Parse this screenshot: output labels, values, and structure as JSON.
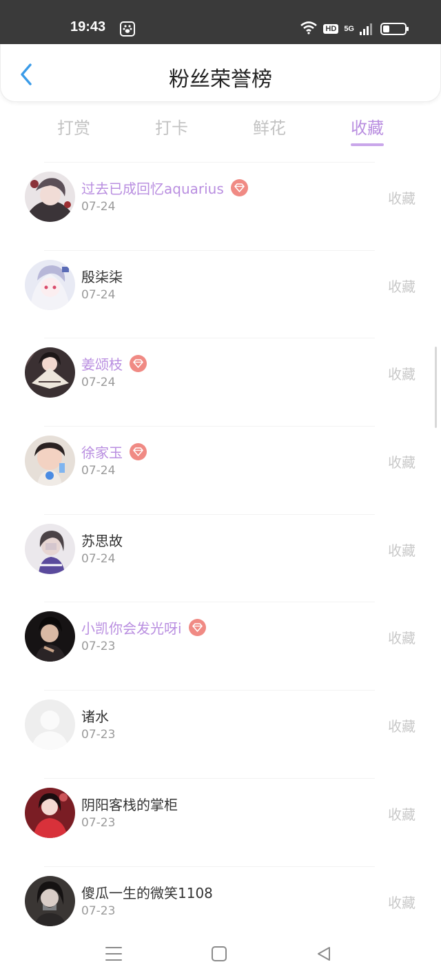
{
  "status_bar": {
    "time": "19:43",
    "hd_label": "HD",
    "network_label": "5G",
    "battery_level": 0.3,
    "icons": [
      "paw-icon",
      "wifi-icon",
      "signal-icon",
      "battery-icon"
    ]
  },
  "header": {
    "title": "粉丝荣誉榜",
    "back_icon": "chevron-left-icon"
  },
  "tabs": [
    {
      "label": "打赏",
      "active": false
    },
    {
      "label": "打卡",
      "active": false
    },
    {
      "label": "鲜花",
      "active": false
    },
    {
      "label": "收藏",
      "active": true
    }
  ],
  "fans": [
    {
      "name": "过去已成回忆aquarius",
      "date": "07-24",
      "action": "收藏",
      "vip": true
    },
    {
      "name": "殷柒柒",
      "date": "07-24",
      "action": "收藏",
      "vip": false
    },
    {
      "name": "姜颂枝",
      "date": "07-24",
      "action": "收藏",
      "vip": true
    },
    {
      "name": "徐家玉",
      "date": "07-24",
      "action": "收藏",
      "vip": true
    },
    {
      "name": "苏思故",
      "date": "07-24",
      "action": "收藏",
      "vip": false
    },
    {
      "name": "小凯你会发光呀i",
      "date": "07-23",
      "action": "收藏",
      "vip": true
    },
    {
      "name": "诸水",
      "date": "07-23",
      "action": "收藏",
      "vip": false
    },
    {
      "name": "阴阳客栈的掌柜",
      "date": "07-23",
      "action": "收藏",
      "vip": false
    },
    {
      "name": "傻瓜一生的微笑1108",
      "date": "07-23",
      "action": "收藏",
      "vip": false
    }
  ],
  "colors": {
    "accent": "#b98ee0",
    "vip_badge": "#f08a84",
    "back_arrow": "#3a9be8",
    "status_bar_bg": "#3a3a3a",
    "muted_text": "#c8c8c8"
  },
  "nav": {
    "icons": [
      "menu-icon",
      "home-square-icon",
      "back-triangle-icon"
    ]
  }
}
